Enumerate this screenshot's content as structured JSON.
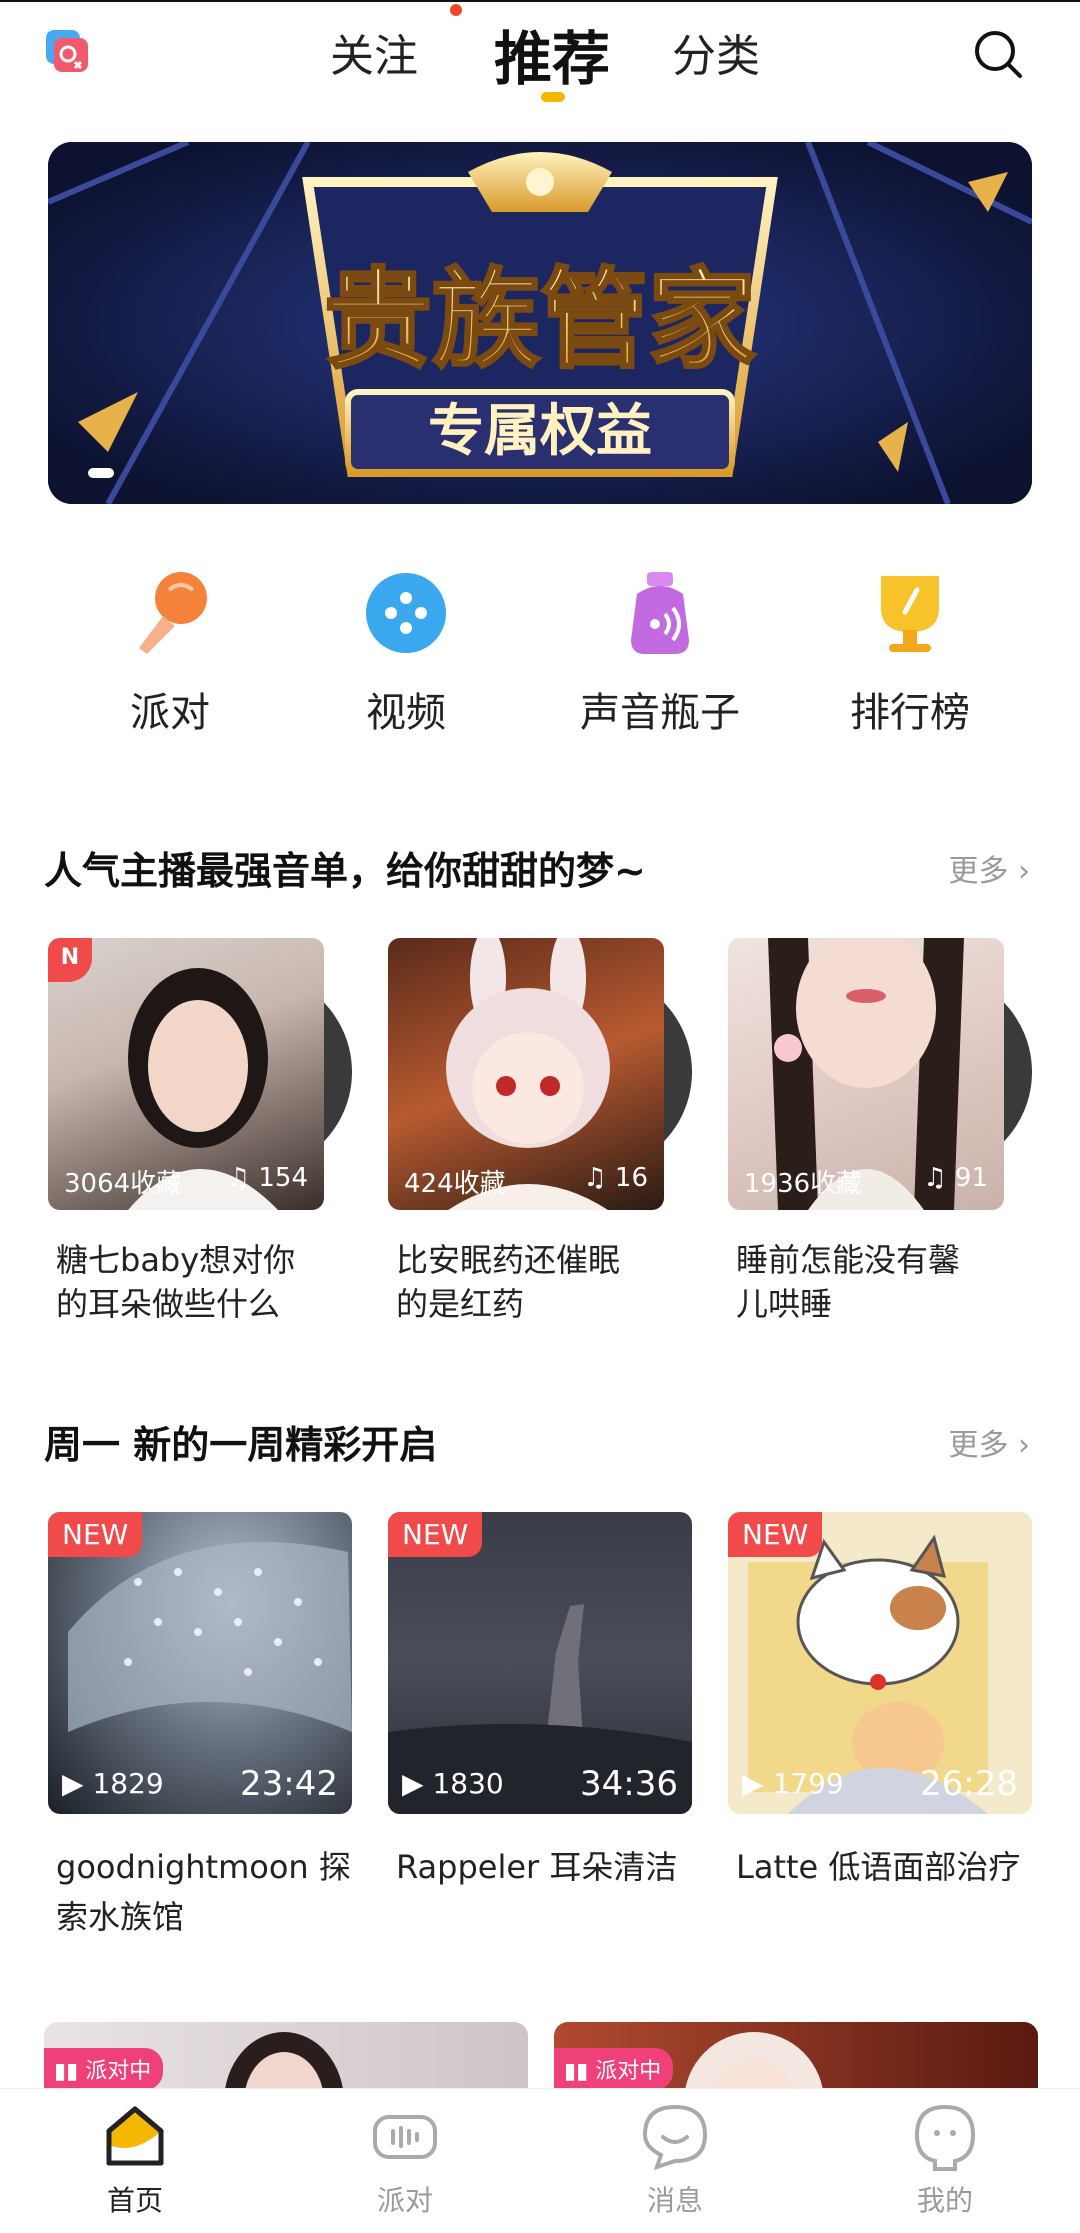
{
  "top_nav": {
    "tabs": [
      {
        "label": "关注",
        "active": false
      },
      {
        "label": "推荐",
        "active": true
      },
      {
        "label": "分类",
        "active": false
      }
    ],
    "accent_color": "#f5b800",
    "search_icon": "search-icon",
    "logo_icon": "app-logo-icon"
  },
  "banner": {
    "title": "贵族管家",
    "subtitle": "专属权益"
  },
  "categories": [
    {
      "label": "派对",
      "icon": "microphone-icon"
    },
    {
      "label": "视频",
      "icon": "video-icon"
    },
    {
      "label": "声音瓶子",
      "icon": "sound-bottle-icon"
    },
    {
      "label": "排行榜",
      "icon": "trophy-icon"
    }
  ],
  "section_playlists": {
    "title": "人气主播最强音单，给你甜甜的梦~",
    "more_label": "更多",
    "items": [
      {
        "favorites": "3064收藏",
        "tracks": "154",
        "title_line1": "糖七baby想对你",
        "title_line2": "的耳朵做些什么",
        "badge": "N"
      },
      {
        "favorites": "424收藏",
        "tracks": "16",
        "title_line1": "比安眠药还催眠",
        "title_line2": "的是红药",
        "badge": ""
      },
      {
        "favorites": "1936收藏",
        "tracks": "91",
        "title_line1": "睡前怎能没有馨",
        "title_line2": "儿哄睡",
        "badge": ""
      }
    ]
  },
  "section_videos": {
    "title": "周一 新的一周精彩开启",
    "more_label": "更多",
    "items": [
      {
        "badge": "NEW",
        "plays": "1829",
        "duration": "23:42",
        "title_line1": "goodnightmoon 探",
        "title_line2": "索水族馆"
      },
      {
        "badge": "NEW",
        "plays": "1830",
        "duration": "34:36",
        "title_line1": "Rappeler 耳朵清洁",
        "title_line2": ""
      },
      {
        "badge": "NEW",
        "plays": "1799",
        "duration": "26:28",
        "title_line1": "Latte 低语面部治疗",
        "title_line2": ""
      }
    ]
  },
  "party_cards": [
    {
      "tag": "派对中"
    },
    {
      "tag": "派对中"
    }
  ],
  "bottom_nav": [
    {
      "label": "首页",
      "icon": "home-icon",
      "active": true
    },
    {
      "label": "派对",
      "icon": "party-icon",
      "active": false
    },
    {
      "label": "消息",
      "icon": "message-icon",
      "active": false
    },
    {
      "label": "我的",
      "icon": "profile-icon",
      "active": false
    }
  ]
}
